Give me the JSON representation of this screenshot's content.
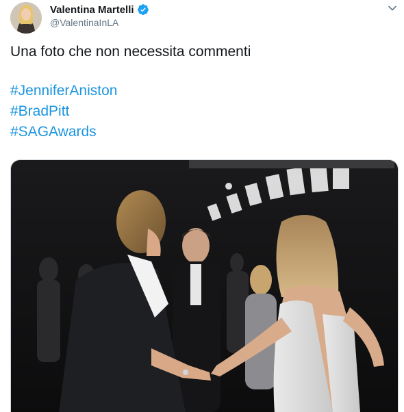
{
  "tweet": {
    "display_name": "Valentina Martelli",
    "handle": "@ValentinaInLA",
    "verified": true,
    "text": "Una foto che non necessita commenti",
    "hashtags": [
      "#JenniferAniston",
      "#BradPitt",
      "#SAGAwards"
    ],
    "avatar_icon": "profile-photo",
    "menu_icon": "chevron-down-icon",
    "colors": {
      "name": "#14171a",
      "handle": "#657786",
      "hashtag": "#1b95e0",
      "verified": "#1da1f2"
    }
  }
}
